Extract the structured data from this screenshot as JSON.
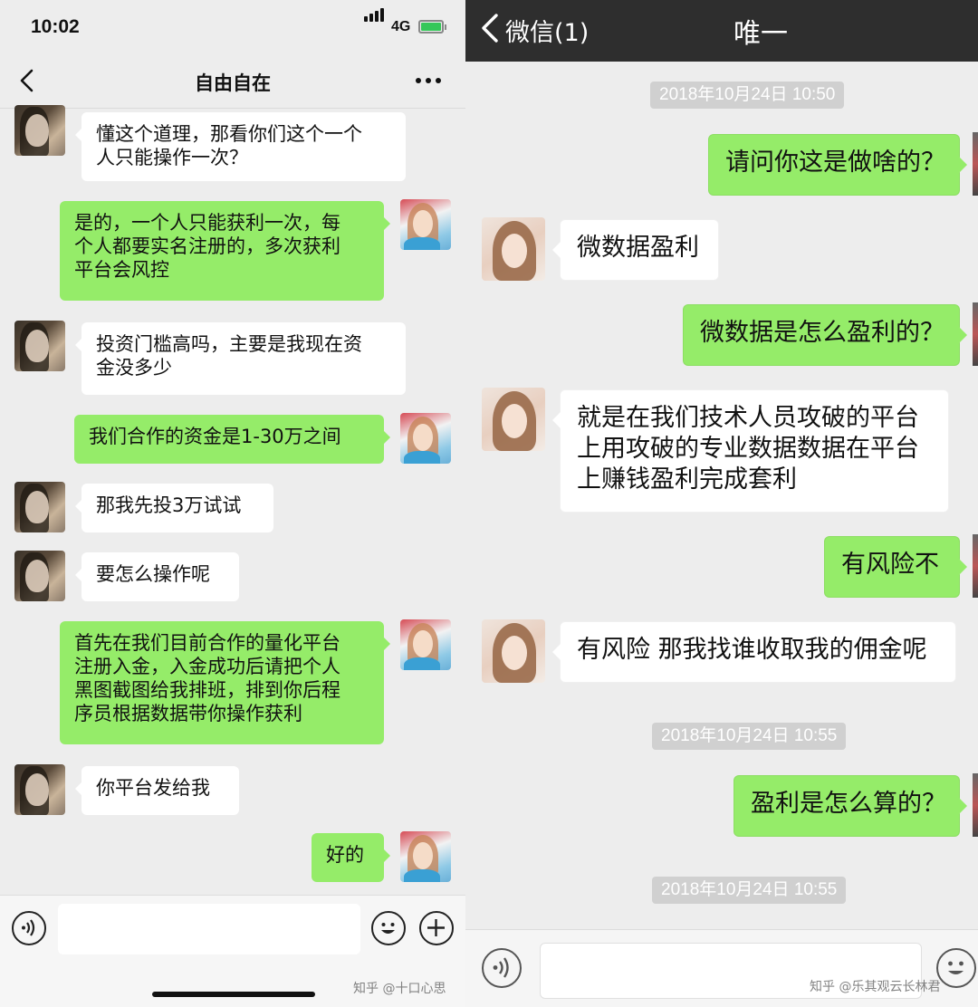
{
  "left": {
    "status": {
      "time": "10:02",
      "network": "4G"
    },
    "header": {
      "title": "自由自在"
    },
    "messages": [
      {
        "from": "user",
        "text": "懂这个道理，那看你们这个一个\n人只能操作一次？"
      },
      {
        "from": "scammer",
        "text": "是的，一个人只能获利一次，每\n个人都要实名注册的，多次获利\n平台会风控"
      },
      {
        "from": "user",
        "text": "投资门槛高吗，主要是我现在资\n金没多少"
      },
      {
        "from": "scammer",
        "text": "我们合作的资金是1-30万之间"
      },
      {
        "from": "user",
        "text": "那我先投3万试试"
      },
      {
        "from": "user",
        "text": "要怎么操作呢"
      },
      {
        "from": "scammer",
        "text": "首先在我们目前合作的量化平台\n注册入金，入金成功后请把个人\n黑图截图给我排班，排到你后程\n序员根据数据带你操作获利"
      },
      {
        "from": "user",
        "text": "你平台发给我"
      },
      {
        "from": "scammer",
        "text": "好的"
      }
    ],
    "watermark": "知乎 @十口心思"
  },
  "right": {
    "header": {
      "back_label": "微信(1)",
      "title": "唯一"
    },
    "items": [
      {
        "kind": "timestamp",
        "text": "2018年10月24日 10:50"
      },
      {
        "kind": "message",
        "from": "self",
        "text": "请问你这是做啥的？"
      },
      {
        "kind": "message",
        "from": "other",
        "text": "微数据盈利"
      },
      {
        "kind": "message",
        "from": "self",
        "text": "微数据是怎么盈利的？"
      },
      {
        "kind": "message",
        "from": "other",
        "text": "就是在我们技术人员攻破的平台\n上用攻破的专业数据数据在平台\n上赚钱盈利完成套利"
      },
      {
        "kind": "message",
        "from": "self",
        "text": "有风险不"
      },
      {
        "kind": "message",
        "from": "other",
        "text": "有风险 那我找谁收取我的佣金呢"
      },
      {
        "kind": "timestamp",
        "text": "2018年10月24日 10:55"
      },
      {
        "kind": "message",
        "from": "self",
        "text": "盈利是怎么算的？"
      },
      {
        "kind": "timestamp",
        "text": "2018年10月24日 10:55"
      }
    ],
    "watermark": "知乎 @乐其观云长林君"
  },
  "icons": {
    "back": "chevron-left-icon",
    "more": "ellipsis-icon",
    "voice": "voice-icon",
    "emoji": "emoji-icon",
    "add": "plus-icon"
  },
  "colors": {
    "self_bubble": "#95ec69",
    "other_bubble": "#ffffff",
    "dark_nav": "#2e2e2e"
  }
}
